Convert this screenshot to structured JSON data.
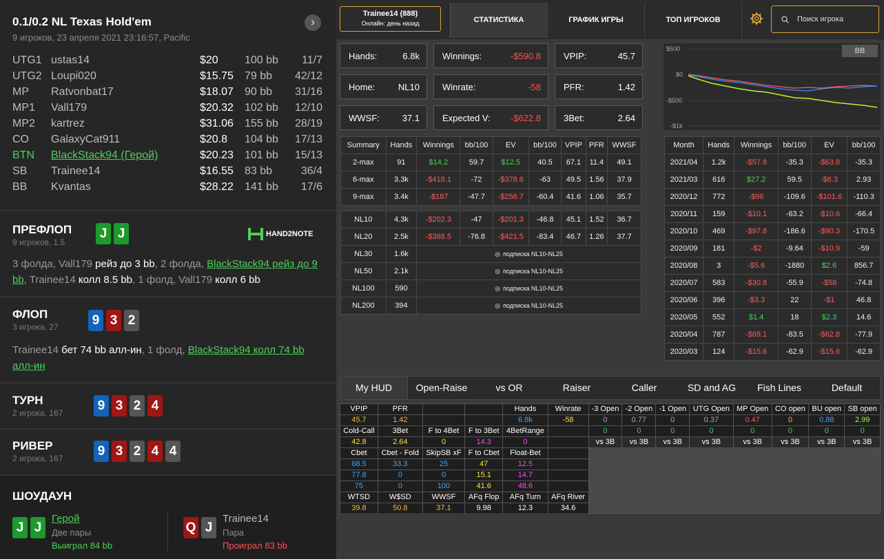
{
  "hand": {
    "title": "0.1/0.2 NL Texas Hold'em",
    "subtitle": "9 игроков, 23 апреля 2021 23:16:57, Pacific",
    "arrow": "›"
  },
  "players": [
    {
      "pos": "UTG1",
      "name": "ustas14",
      "stack": "$20",
      "bb": "100 bb",
      "hands": "11/7",
      "hero": false
    },
    {
      "pos": "UTG2",
      "name": "Loupi020",
      "stack": "$15.75",
      "bb": "79 bb",
      "hands": "42/12",
      "hero": false
    },
    {
      "pos": "MP",
      "name": "Ratvonbat17",
      "stack": "$18.07",
      "bb": "90 bb",
      "hands": "31/16",
      "hero": false
    },
    {
      "pos": "MP1",
      "name": "Vall179",
      "stack": "$20.32",
      "bb": "102 bb",
      "hands": "12/10",
      "hero": false
    },
    {
      "pos": "MP2",
      "name": "kartrez",
      "stack": "$31.06",
      "bb": "155 bb",
      "hands": "28/19",
      "hero": false
    },
    {
      "pos": "CO",
      "name": "GalaxyCat911",
      "stack": "$20.8",
      "bb": "104 bb",
      "hands": "17/13",
      "hero": false
    },
    {
      "pos": "BTN",
      "name": "BlackStack94 (Герой)",
      "stack": "$20.23",
      "bb": "101 bb",
      "hands": "15/13",
      "hero": true
    },
    {
      "pos": "SB",
      "name": "Trainee14",
      "stack": "$16.55",
      "bb": "83 bb",
      "hands": "36/4",
      "hero": false
    },
    {
      "pos": "BB",
      "name": "Kvantas",
      "stack": "$28.22",
      "bb": "141 bb",
      "hands": "17/6",
      "hero": false
    }
  ],
  "preflop": {
    "title": "ПРЕФЛОП",
    "sub": "9 игроков, 1.5",
    "logo": "HAND2NOTE",
    "a1": "3 фолда, Vall179 ",
    "b1": "рейз до 3 bb",
    "a2": ", 2 фолда, ",
    "hero": "BlackStack94 рейз до 9 bb",
    "a3": ", Trainee14 ",
    "b2": "колл 8.5 bb",
    "a4": ", 1 фолд, Vall179 ",
    "b3": "колл 6 bb"
  },
  "flop": {
    "title": "ФЛОП",
    "sub": "3 игрока, 27",
    "a1": "Trainee14 ",
    "b1": "бет 74 bb алл-ин",
    "a2": ", 1 фолд, ",
    "hero": "BlackStack94 колл 74 bb алл-ин"
  },
  "turn": {
    "title": "ТУРН",
    "sub": "2 игрока, 167"
  },
  "river": {
    "title": "РИВЕР",
    "sub": "2 игрока, 167"
  },
  "showdown": {
    "title": "ШОУДАУН",
    "hero_name": "Герой",
    "hero_hand": "Две пары",
    "hero_result": "Выиграл 84 bb",
    "opp_name": "Trainee14",
    "opp_hand": "Пара",
    "opp_result": "Проиграл 83 bb"
  },
  "cards": {
    "pre": [
      "J",
      "J"
    ],
    "flop": [
      "9",
      "3",
      "2"
    ],
    "turn": [
      "9",
      "3",
      "2",
      "4"
    ],
    "river": [
      "9",
      "3",
      "2",
      "4",
      "4"
    ],
    "hero_sd": [
      "J",
      "J"
    ],
    "opp_sd": [
      "Q",
      "J"
    ]
  },
  "topbar": {
    "player": "Trainee14 (888)",
    "online": "Онлайн: день назад",
    "tabs": [
      "СТАТИСТИКА",
      "ГРАФИК ИГРЫ",
      "ТОП ИГРОКОВ"
    ],
    "search_placeholder": "Поиск игрока"
  },
  "stats": {
    "hands_k": "Hands:",
    "hands_v": "6.8k",
    "win_k": "Winnings:",
    "win_v": "-$590.8",
    "vpip_k": "VPIP:",
    "vpip_v": "45.7",
    "home_k": "Home:",
    "home_v": "NL10",
    "wr_k": "Winrate:",
    "wr_v": "-58",
    "pfr_k": "PFR:",
    "pfr_v": "1.42",
    "wwsf_k": "WWSF:",
    "wwsf_v": "37.1",
    "ev_k": "Expected V:",
    "ev_v": "-$622.8",
    "tb_k": "3Bet:",
    "tb_v": "2.64"
  },
  "graph": {
    "badge": "BB",
    "yticks": [
      "$500",
      "$0",
      "-$500",
      "-$1k"
    ]
  },
  "summary": {
    "headers": [
      "Summary",
      "Hands",
      "Winnings",
      "bb/100",
      "EV",
      "bb/100",
      "VPIP",
      "PFR",
      "WWSF"
    ],
    "rows": [
      [
        "2-max",
        "91",
        "$14.2",
        "59.7",
        "$12.5",
        "40.5",
        "67.1",
        "11.4",
        "49.1"
      ],
      [
        "6-max",
        "3.3k",
        "-$418.1",
        "-72",
        "-$378.6",
        "-63",
        "49.5",
        "1.56",
        "37.9"
      ],
      [
        "9-max",
        "3.4k",
        "-$187",
        "-47.7",
        "-$256.7",
        "-60.4",
        "41.6",
        "1.06",
        "35.7"
      ]
    ],
    "limits": [
      [
        "NL10",
        "4.3k",
        "-$202.3",
        "-47",
        "-$201.3",
        "-46.8",
        "45.1",
        "1.52",
        "36.7"
      ],
      [
        "NL20",
        "2.5k",
        "-$388.5",
        "-76.8",
        "-$421.5",
        "-83.4",
        "46.7",
        "1.26",
        "37.7"
      ]
    ],
    "locked": [
      [
        "NL30",
        "1.6k"
      ],
      [
        "NL50",
        "2.1k"
      ],
      [
        "NL100",
        "590"
      ],
      [
        "NL200",
        "394"
      ]
    ],
    "lock_text": "подписка NL10-NL25"
  },
  "months": {
    "headers": [
      "Month",
      "Hands",
      "Winnings",
      "bb/100",
      "EV",
      "bb/100"
    ],
    "rows": [
      [
        "2021/04",
        "1.2k",
        "-$57.8",
        "-35.3",
        "-$63.8",
        "-35.3"
      ],
      [
        "2021/03",
        "616",
        "$27.2",
        "59.5",
        "-$6.3",
        "2.93"
      ],
      [
        "2020/12",
        "772",
        "-$96",
        "-109.6",
        "-$101.6",
        "-110.3"
      ],
      [
        "2020/11",
        "159",
        "-$10.1",
        "-63.2",
        "-$10.6",
        "-66.4"
      ],
      [
        "2020/10",
        "469",
        "-$97.8",
        "-186.6",
        "-$90.3",
        "-170.5"
      ],
      [
        "2020/09",
        "181",
        "-$2",
        "-9.64",
        "-$10.9",
        "-59"
      ],
      [
        "2020/08",
        "3",
        "-$5.6",
        "-1880",
        "$2.6",
        "856.7"
      ],
      [
        "2020/07",
        "583",
        "-$30.8",
        "-55.9",
        "-$58",
        "-74.8"
      ],
      [
        "2020/06",
        "396",
        "-$3.3",
        "22",
        "-$1",
        "46.8"
      ],
      [
        "2020/05",
        "552",
        "$1.4",
        "18",
        "$2.3",
        "14.6"
      ],
      [
        "2020/04",
        "787",
        "-$69.1",
        "-83.5",
        "-$62.8",
        "-77.9"
      ],
      [
        "2020/03",
        "124",
        "-$15.6",
        "-62.9",
        "-$15.6",
        "-62.9"
      ]
    ]
  },
  "hudtabs": [
    "My HUD",
    "Open-Raise",
    "vs OR",
    "Raiser",
    "Caller",
    "SD and AG",
    "Fish Lines",
    "Default"
  ],
  "hud": {
    "r1": [
      "VPIP",
      "PFR",
      "",
      "",
      "Hands",
      "Winrate",
      "-3 Open",
      "-2 Open",
      "-1 Open",
      "UTG Open",
      "MP Open",
      "CO open",
      "BU open",
      "SB open"
    ],
    "r2": [
      "45.7",
      "1.42",
      "",
      "",
      "6.8k",
      "-58",
      "0",
      "0.77",
      "0",
      "0.37",
      "0.47",
      "0",
      "0.88",
      "2.99"
    ],
    "r3": [
      "Cold-Call",
      "3Bet",
      "F to 4Bet",
      "F to 3Bet",
      "4BetRange"
    ],
    "r4": [
      "42.8",
      "2.64",
      "0",
      "14.3",
      "0"
    ],
    "r4b": [
      "0",
      "0",
      "0",
      "0",
      "0",
      "0",
      "0",
      "0"
    ],
    "r4c": [
      "vs 3B",
      "vs 3B",
      "vs 3B",
      "vs 3B",
      "vs 3B",
      "vs 3B",
      "vs 3B",
      "vs 3B"
    ],
    "r5": [
      "Cbet",
      "Cbet - Fold",
      "SkipSB xF",
      "F to Cbet",
      "Float-Bet"
    ],
    "r6": [
      "68.5",
      "33.3",
      "25",
      "47",
      "12.5"
    ],
    "r7": [
      "77.8",
      "0",
      "0",
      "15.1",
      "14.7"
    ],
    "r8": [
      "75",
      "0",
      "100",
      "41.6",
      "48.6"
    ],
    "r9": [
      "WTSD",
      "W$SD",
      "WWSF",
      "AFq Flop",
      "AFq Turn",
      "AFq River"
    ],
    "r10": [
      "39.8",
      "50.8",
      "37.1",
      "9.98",
      "12.3",
      "34.6"
    ]
  },
  "colors": {
    "green": "#4cd05a",
    "red": "#ff5050",
    "accent": "#e0a040"
  }
}
